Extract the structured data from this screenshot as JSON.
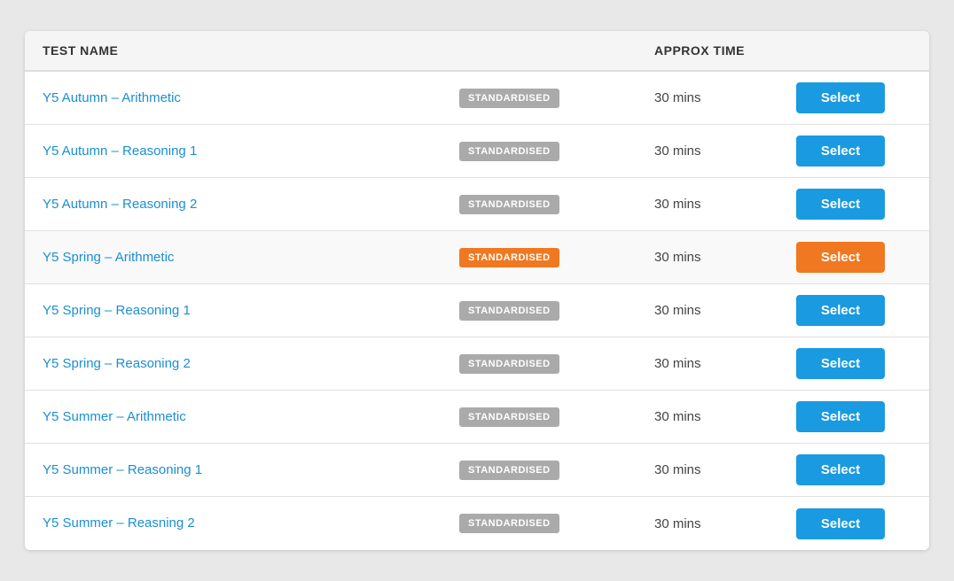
{
  "table": {
    "headers": {
      "test_name": "TEST NAME",
      "approx_time": "APPROX TIME"
    },
    "rows": [
      {
        "id": 1,
        "name": "Y5 Autumn – Arithmetic",
        "badge_label": "STANDARDISED",
        "badge_type": "grey",
        "time": "30 mins",
        "select_label": "Select",
        "select_type": "blue",
        "highlighted": false
      },
      {
        "id": 2,
        "name": "Y5 Autumn – Reasoning 1",
        "badge_label": "STANDARDISED",
        "badge_type": "grey",
        "time": "30 mins",
        "select_label": "Select",
        "select_type": "blue",
        "highlighted": false
      },
      {
        "id": 3,
        "name": "Y5 Autumn – Reasoning 2",
        "badge_label": "STANDARDISED",
        "badge_type": "grey",
        "time": "30 mins",
        "select_label": "Select",
        "select_type": "blue",
        "highlighted": false
      },
      {
        "id": 4,
        "name": "Y5 Spring – Arithmetic",
        "badge_label": "STANDARDISED",
        "badge_type": "orange",
        "time": "30 mins",
        "select_label": "Select",
        "select_type": "orange",
        "highlighted": true
      },
      {
        "id": 5,
        "name": "Y5 Spring – Reasoning 1",
        "badge_label": "STANDARDISED",
        "badge_type": "grey",
        "time": "30 mins",
        "select_label": "Select",
        "select_type": "blue",
        "highlighted": false
      },
      {
        "id": 6,
        "name": "Y5 Spring – Reasoning 2",
        "badge_label": "STANDARDISED",
        "badge_type": "grey",
        "time": "30 mins",
        "select_label": "Select",
        "select_type": "blue",
        "highlighted": false
      },
      {
        "id": 7,
        "name": "Y5 Summer – Arithmetic",
        "badge_label": "STANDARDISED",
        "badge_type": "grey",
        "time": "30 mins",
        "select_label": "Select",
        "select_type": "blue",
        "highlighted": false
      },
      {
        "id": 8,
        "name": "Y5 Summer – Reasoning 1",
        "badge_label": "STANDARDISED",
        "badge_type": "grey",
        "time": "30 mins",
        "select_label": "Select",
        "select_type": "blue",
        "highlighted": false
      },
      {
        "id": 9,
        "name": "Y5 Summer – Reasning 2",
        "badge_label": "STANDARDISED",
        "badge_type": "grey",
        "time": "30 mins",
        "select_label": "Select",
        "select_type": "blue",
        "highlighted": false
      }
    ]
  }
}
